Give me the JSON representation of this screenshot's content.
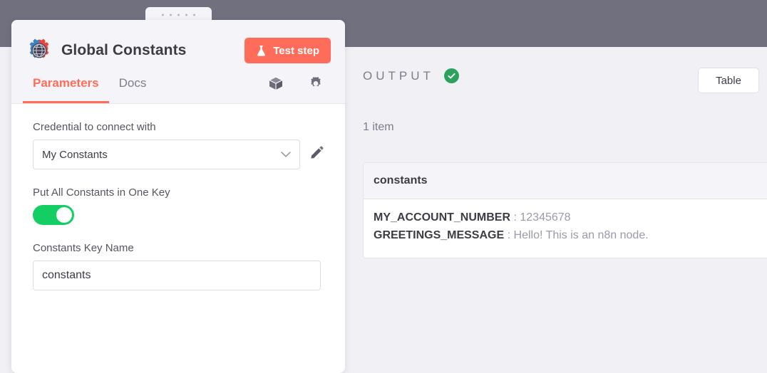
{
  "window": {
    "drag_handle": "drag-handle-dots"
  },
  "node_panel": {
    "title": "Global Constants",
    "icon": "global-constants-gear-globe-icon",
    "test_step_button": "Test step",
    "tabs": [
      {
        "label": "Parameters",
        "active": true
      },
      {
        "label": "Docs",
        "active": false
      }
    ],
    "header_icons": [
      {
        "name": "cube-icon"
      },
      {
        "name": "gear-icon"
      }
    ],
    "fields": {
      "credential": {
        "label": "Credential to connect with",
        "value": "My Constants",
        "edit_icon": "pencil-icon",
        "chevron_icon": "chevron-down-icon"
      },
      "put_all_in_one_key": {
        "label": "Put All Constants in One Key",
        "enabled": true
      },
      "constants_key_name": {
        "label": "Constants Key Name",
        "value": "constants",
        "placeholder": "constants"
      }
    }
  },
  "output": {
    "label": "OUTPUT",
    "status_icon": "success-check-icon",
    "view_button": "Table",
    "item_count": "1 item",
    "table": {
      "column_header": "constants",
      "rows": [
        {
          "key": "MY_ACCOUNT_NUMBER",
          "separator": ":",
          "value": "12345678"
        },
        {
          "key": "GREETINGS_MESSAGE",
          "separator": ":",
          "value": "Hello! This is an n8n node."
        }
      ]
    }
  },
  "colors": {
    "accent": "#ff6d5a",
    "toggle_on": "#12ce63",
    "success": "#2ba35f",
    "topbar": "#71707e",
    "canvas": "#f0f0f5"
  }
}
